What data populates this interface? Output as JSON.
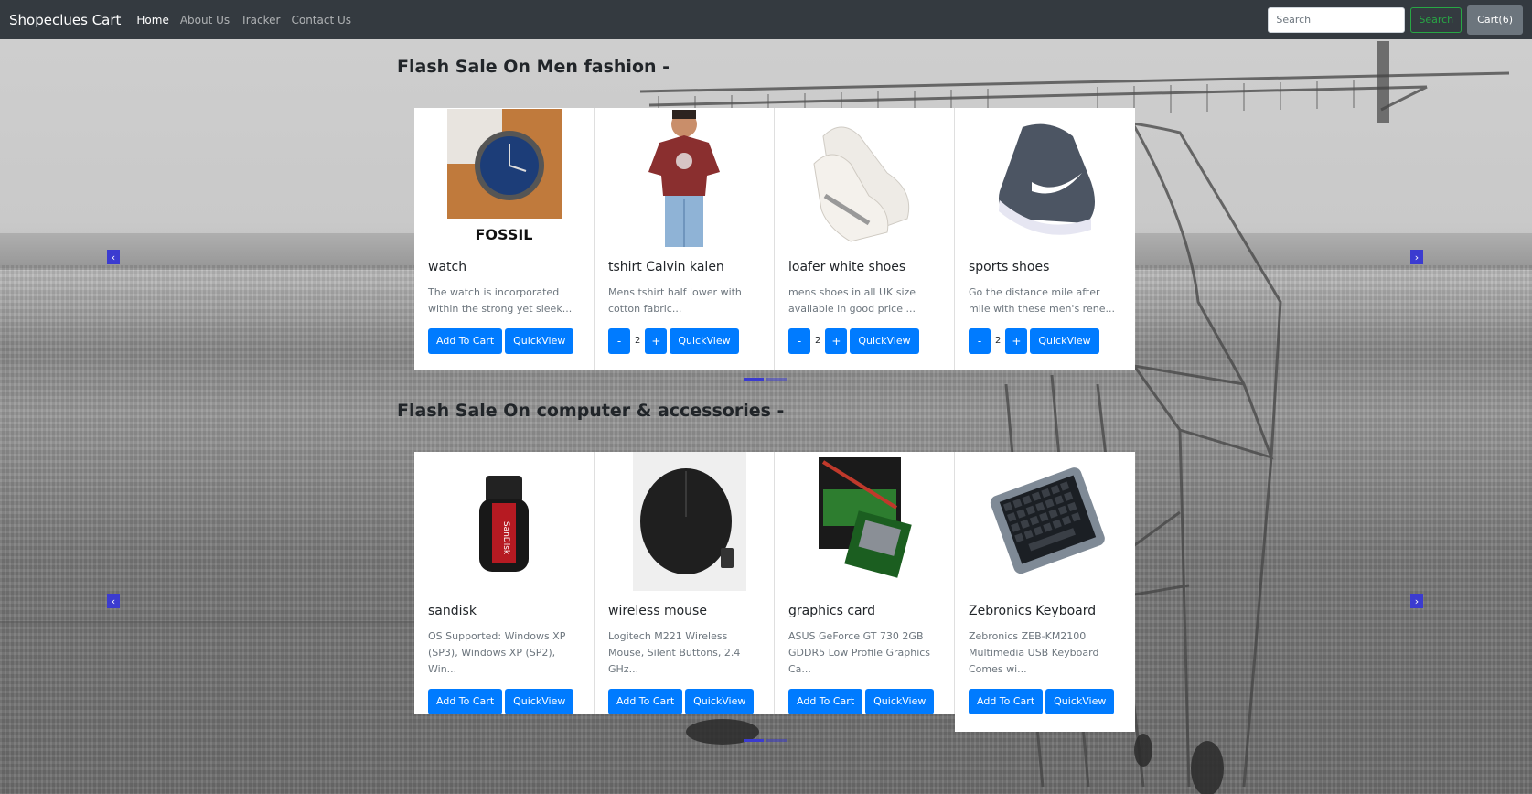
{
  "navbar": {
    "brand": "Shopeclues Cart",
    "links": [
      "Home",
      "About Us",
      "Tracker",
      "Contact Us"
    ],
    "search_placeholder": "Search",
    "search_button": "Search",
    "cart_button": "Cart(6)"
  },
  "sections": [
    {
      "title": "Flash Sale On Men fashion -",
      "products": [
        {
          "name": "watch",
          "desc": "The watch is incorporated within the strong yet sleek...",
          "in_cart": false,
          "qty": null,
          "add_label": "Add To Cart",
          "quick_label": "QuickView",
          "image": "watch-image",
          "brand_text": "FOSSIL"
        },
        {
          "name": "tshirt Calvin kalen",
          "desc": "Mens tshirt half lower with cotton fabric...",
          "in_cart": true,
          "qty": "2",
          "quick_label": "QuickView",
          "image": "tshirt-image"
        },
        {
          "name": "loafer white shoes",
          "desc": "mens shoes in all UK size available in good price ...",
          "in_cart": true,
          "qty": "2",
          "quick_label": "QuickView",
          "image": "white-shoes-image"
        },
        {
          "name": "sports shoes",
          "desc": "Go the distance mile after mile with these men's rene...",
          "in_cart": true,
          "qty": "2",
          "quick_label": "QuickView",
          "image": "sports-shoes-image"
        }
      ]
    },
    {
      "title": "Flash Sale On computer & accessories -",
      "products": [
        {
          "name": "sandisk",
          "desc": "OS Supported: Windows XP (SP3), Windows XP (SP2), Win...",
          "add_label": "Add To Cart",
          "quick_label": "QuickView",
          "image": "usb-drive-image",
          "brand_text": "SanDisk"
        },
        {
          "name": "wireless mouse",
          "desc": "Logitech M221 Wireless Mouse, Silent Buttons, 2.4 GHz...",
          "add_label": "Add To Cart",
          "quick_label": "QuickView",
          "image": "mouse-image"
        },
        {
          "name": "graphics card",
          "desc": "ASUS GeForce GT 730 2GB GDDR5 Low Profile Graphics Ca...",
          "add_label": "Add To Cart",
          "quick_label": "QuickView",
          "image": "graphics-card-image"
        },
        {
          "name": "Zebronics Keyboard",
          "desc": "Zebronics ZEB-KM2100 Multimedia USB Keyboard Comes wi...",
          "add_label": "Add To Cart",
          "quick_label": "QuickView",
          "image": "keyboard-image"
        }
      ]
    }
  ],
  "qty_minus": "-",
  "qty_plus": "+",
  "carousel_prev": "‹",
  "carousel_next": "›"
}
